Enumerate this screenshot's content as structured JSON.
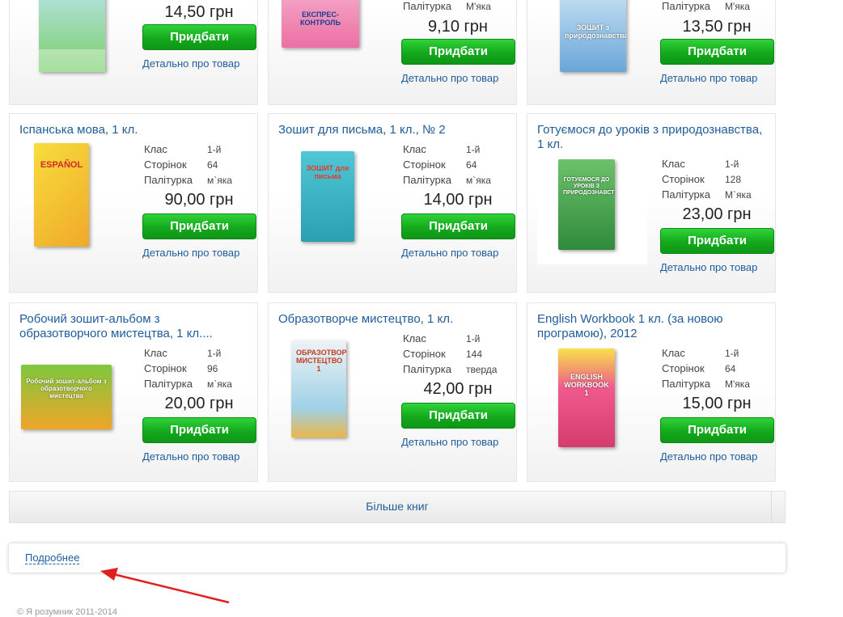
{
  "labels": {
    "class": "Клас",
    "pages": "Сторінок",
    "cover": "Палітурка",
    "buy": "Придбати",
    "details": "Детально про товар"
  },
  "top_row": [
    {
      "price": "14,50 грн"
    },
    {
      "cover_text": "ЕКСПРЕС-КОНТРОЛЬ",
      "cover_value": "М'яка",
      "price": "9,10 грн"
    },
    {
      "cover_text": "ЗОШИТ з природознавства",
      "cover_value": "М'яка",
      "price": "13,50 грн"
    }
  ],
  "products": [
    {
      "title": "Іспанська мова, 1 кл.",
      "cover_text": "ESPAÑOL",
      "class": "1-й",
      "pages": "64",
      "cover": "м`яка",
      "price": "90,00 грн",
      "color": "#f5d22e"
    },
    {
      "title": "Зошит для письма, 1 кл., № 2",
      "cover_text": "ЗОШИТ для письма",
      "class": "1-й",
      "pages": "64",
      "cover": "м`яка",
      "price": "14,00 грн",
      "color": "#2fb6c8"
    },
    {
      "title": "Готуємося до уроків з природознавства, 1 кл.",
      "cover_text": "ГОТУЄМОСЯ ДО УРОКІВ З ПРИРОДОЗНАВСТВА",
      "class": "1-й",
      "pages": "128",
      "cover": "М`яка",
      "price": "23,00 грн",
      "color": "#3e9e3a"
    },
    {
      "title": "Робочий зошит-альбом з образотворчого мистецтва, 1 кл....",
      "cover_text": "Робочий зошит-альбом з образотворчого мистецтва",
      "class": "1-й",
      "pages": "96",
      "cover": "м`яка",
      "price": "20,00 грн",
      "color": "#6bb332"
    },
    {
      "title": "Образотворче мистецтво, 1 кл.",
      "cover_text": "ОБРАЗОТВОРЧЕ МИСТЕЦТВО 1",
      "class": "1-й",
      "pages": "144",
      "cover": "тверда",
      "price": "42,00 грн",
      "color": "#e8eef2"
    },
    {
      "title": "English Workbook 1 кл. (за новою програмою), 2012",
      "cover_text": "ENGLISH WORKBOOK 1",
      "class": "1-й",
      "pages": "64",
      "cover": "М'яка",
      "price": "15,00 грн",
      "color": "#f05a8c"
    }
  ],
  "more_books": "Більше книг",
  "details_link": "Подробнее",
  "footer": "© Я розумник 2011-2014",
  "colors": {
    "link": "#1f5c99",
    "buy_button": "#14a91c",
    "arrow": "#e02020"
  }
}
